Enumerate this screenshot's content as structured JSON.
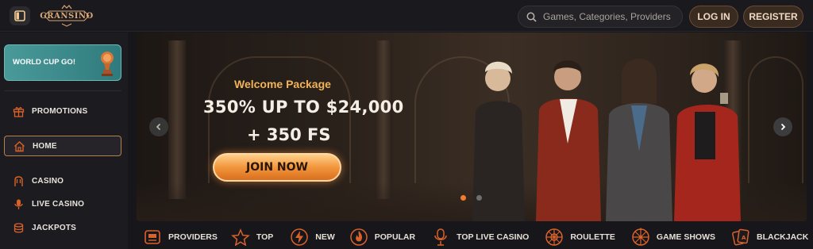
{
  "header": {
    "logo_text": "GRANSINO",
    "search_placeholder": "Games, Categories, Providers",
    "login_label": "LOG IN",
    "register_label": "REGISTER"
  },
  "sidebar": {
    "promo_card": "WORLD CUP GO!",
    "items": [
      {
        "label": "PROMOTIONS",
        "icon": "gift-icon"
      },
      {
        "label": "HOME",
        "icon": "home-icon",
        "active": true
      },
      {
        "label": "CASINO",
        "icon": "slot-machine-icon"
      },
      {
        "label": "LIVE CASINO",
        "icon": "microphone-icon"
      },
      {
        "label": "JACKPOTS",
        "icon": "coins-icon"
      }
    ]
  },
  "banner": {
    "headline": "Welcome Package",
    "offer_line1": "350% UP TO $24,000",
    "offer_line2": "+ 350 FS",
    "cta_label": "JOIN NOW",
    "slide_indicator": {
      "active": 1,
      "total": 2
    }
  },
  "categories": [
    {
      "label": "PROVIDERS",
      "icon": "providers-icon"
    },
    {
      "label": "TOP",
      "icon": "star-icon"
    },
    {
      "label": "NEW",
      "icon": "lightning-icon"
    },
    {
      "label": "POPULAR",
      "icon": "flame-icon"
    },
    {
      "label": "TOP LIVE CASINO",
      "icon": "microphone-icon"
    },
    {
      "label": "ROULETTE",
      "icon": "roulette-icon"
    },
    {
      "label": "GAME SHOWS",
      "icon": "wheel-icon"
    },
    {
      "label": "BLACKJACK",
      "icon": "cards-icon"
    }
  ],
  "colors": {
    "accent": "#f2963c",
    "gold_text": "#f1b258",
    "teal_card": "#3d8c8c",
    "icon_orange": "#d9622b"
  }
}
